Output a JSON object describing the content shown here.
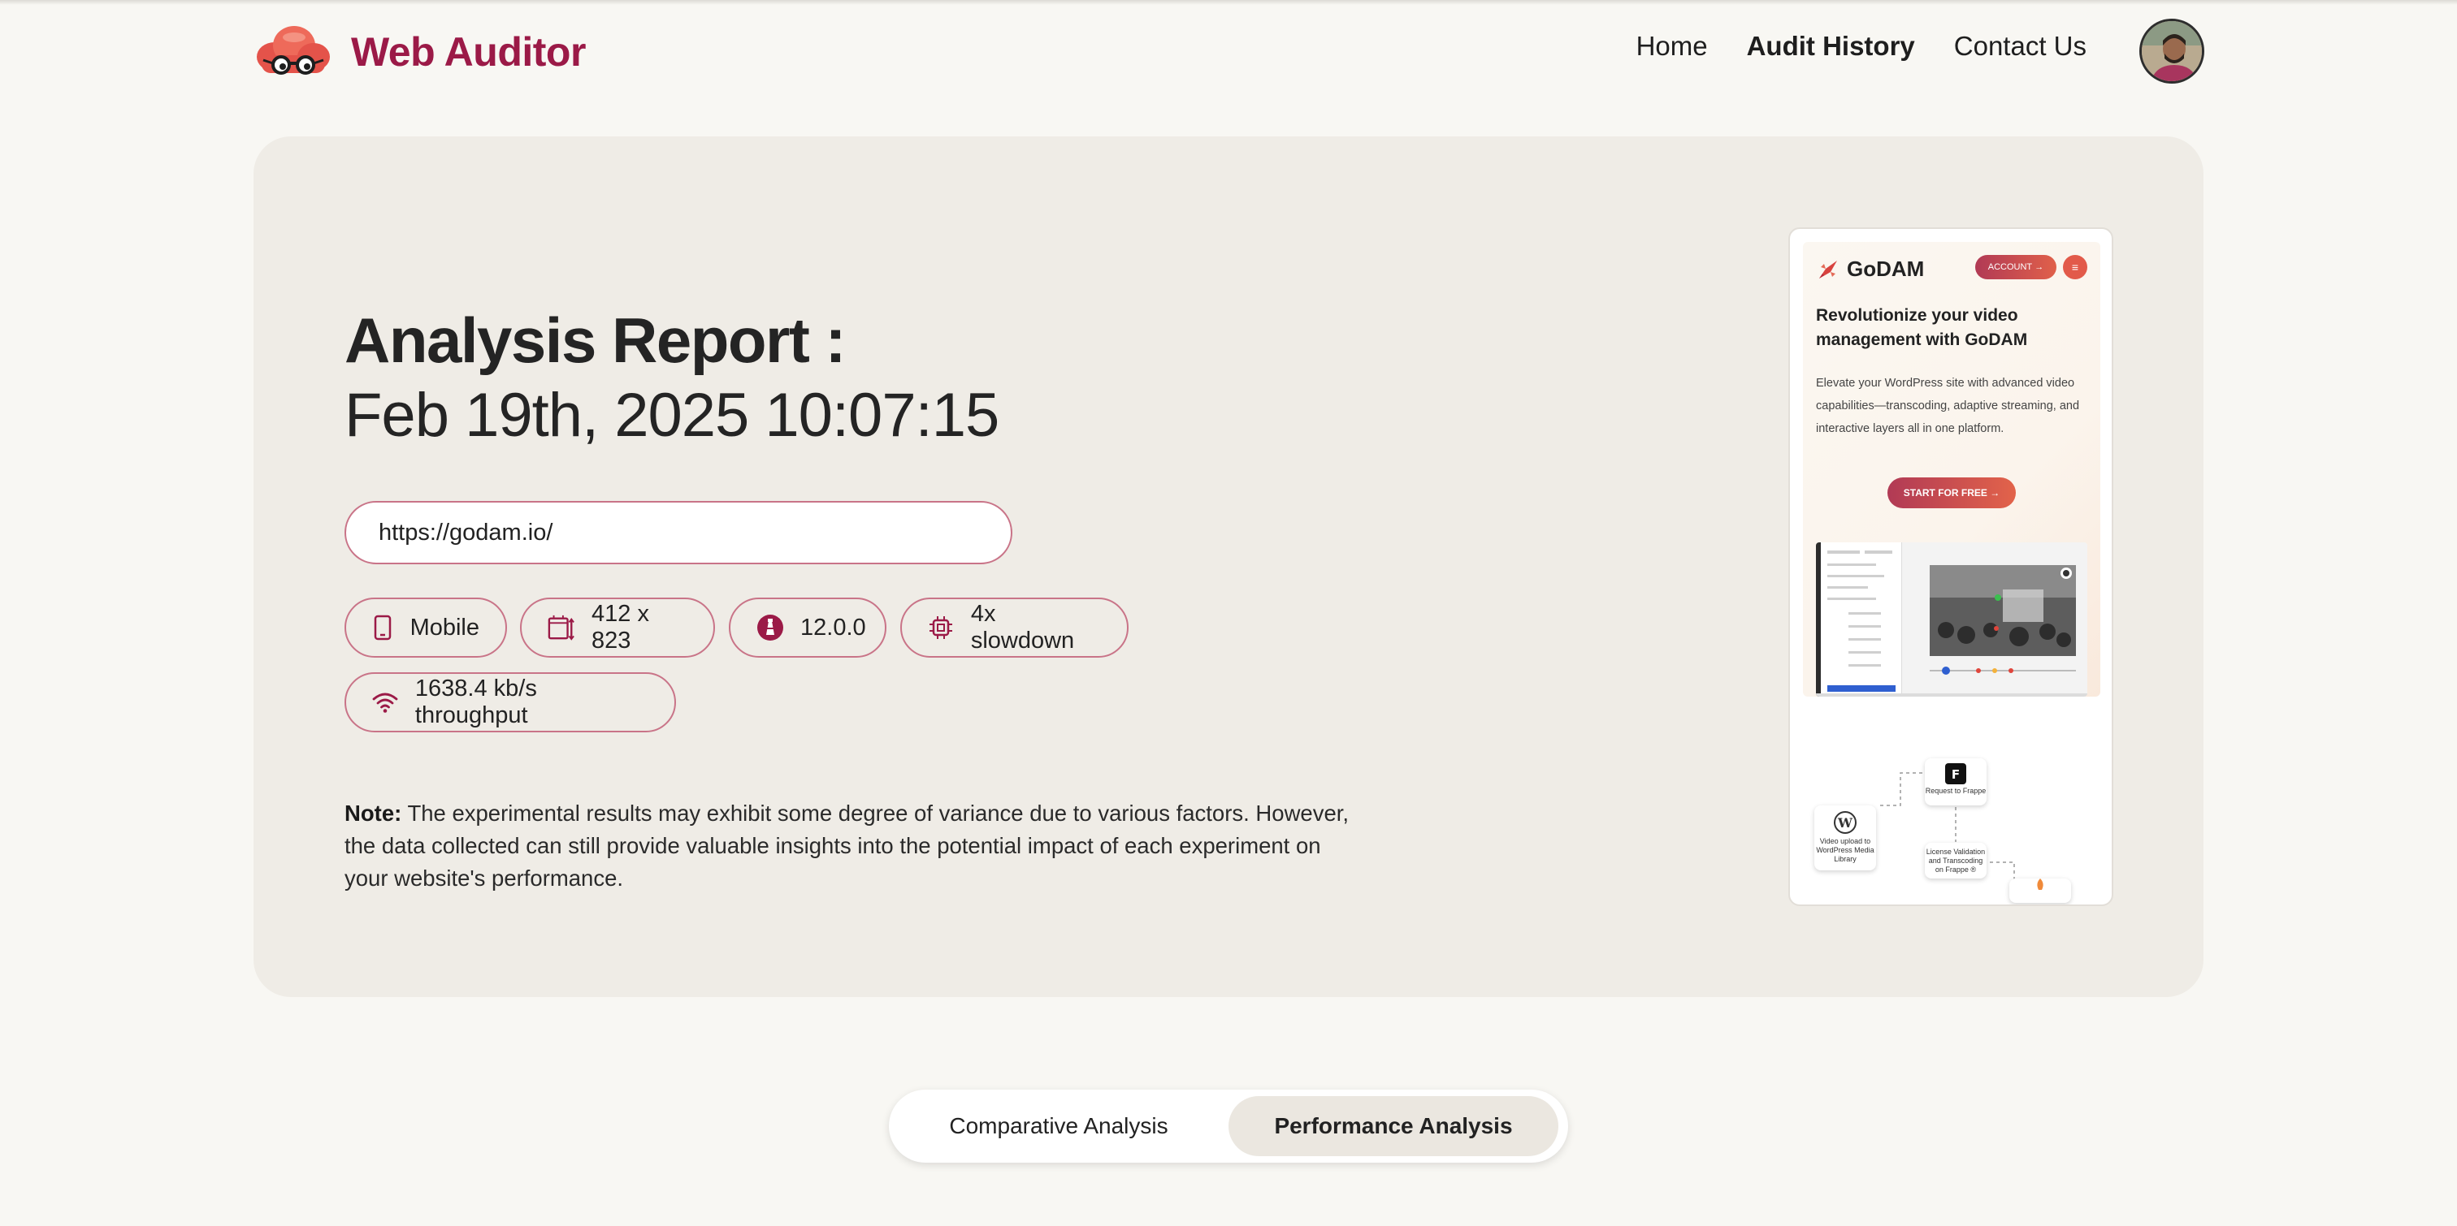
{
  "app": {
    "name": "Web Auditor"
  },
  "nav": {
    "home": "Home",
    "audit_history": "Audit History",
    "contact": "Contact Us"
  },
  "report": {
    "title": "Analysis Report :",
    "datetime": "Feb 19th, 2025 10:07:15",
    "url": "https://godam.io/",
    "chips": {
      "device": "Mobile",
      "viewport": "412 x 823",
      "lighthouse_version": "12.0.0",
      "cpu": "4x slowdown",
      "network": "1638.4 kb/s throughput"
    },
    "note_label": "Note:",
    "note_text": "The experimental results may exhibit some degree of variance due to various factors. However, the data collected can still provide valuable insights into the potential impact of each experiment on your website's performance."
  },
  "preview": {
    "logo": "GoDAM",
    "account": "ACCOUNT",
    "headline": "Revolutionize your video management with GoDAM",
    "body": "Elevate your WordPress site with advanced video capabilities—transcoding, adaptive streaming, and interactive layers all in one platform.",
    "cta": "START FOR FREE",
    "node_wp": "Video upload to WordPress Media Library",
    "node_frappe": "Request to Frappe",
    "node_license": "License Validation and Transcoding on Frappe ®"
  },
  "tabs": {
    "comparative": "Comparative Analysis",
    "performance": "Performance Analysis",
    "selected": "performance"
  },
  "colors": {
    "brand": "#9b1a47",
    "chip_border": "#c97488",
    "background": "#f8f7f3",
    "card": "#efece6"
  }
}
